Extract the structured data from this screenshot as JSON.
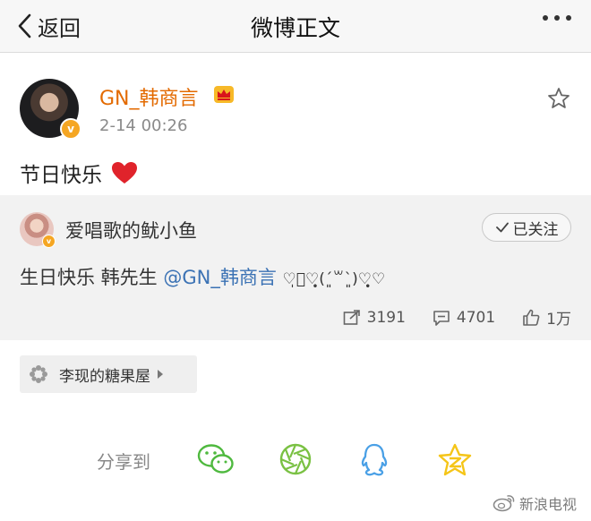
{
  "nav": {
    "back_label": "返回",
    "title": "微博正文"
  },
  "post": {
    "username": "GN_韩商言",
    "time": "2-14 00:26",
    "text": "节日快乐"
  },
  "repost": {
    "username": "爱唱歌的鱿小鱼",
    "follow_label": "已关注",
    "text_prefix": "生日快乐 韩先生 ",
    "mention": "@GN_韩商言",
    "emoticon": "♡̩͙♡̩̥̩(ˊ͈꒳ˋ͈)♡̩̥̩♡",
    "reposts": "3191",
    "comments": "4701",
    "likes": "1万"
  },
  "location": {
    "label": "李现的糖果屋"
  },
  "share": {
    "label": "分享到"
  },
  "watermark": {
    "text": "新浪电视"
  },
  "colors": {
    "username": "#e36a00",
    "mention": "#3b72b4",
    "wechat": "#4fb93f",
    "moments": "#7ac143",
    "qq": "#4aa0e6",
    "qzone": "#f5c518"
  }
}
